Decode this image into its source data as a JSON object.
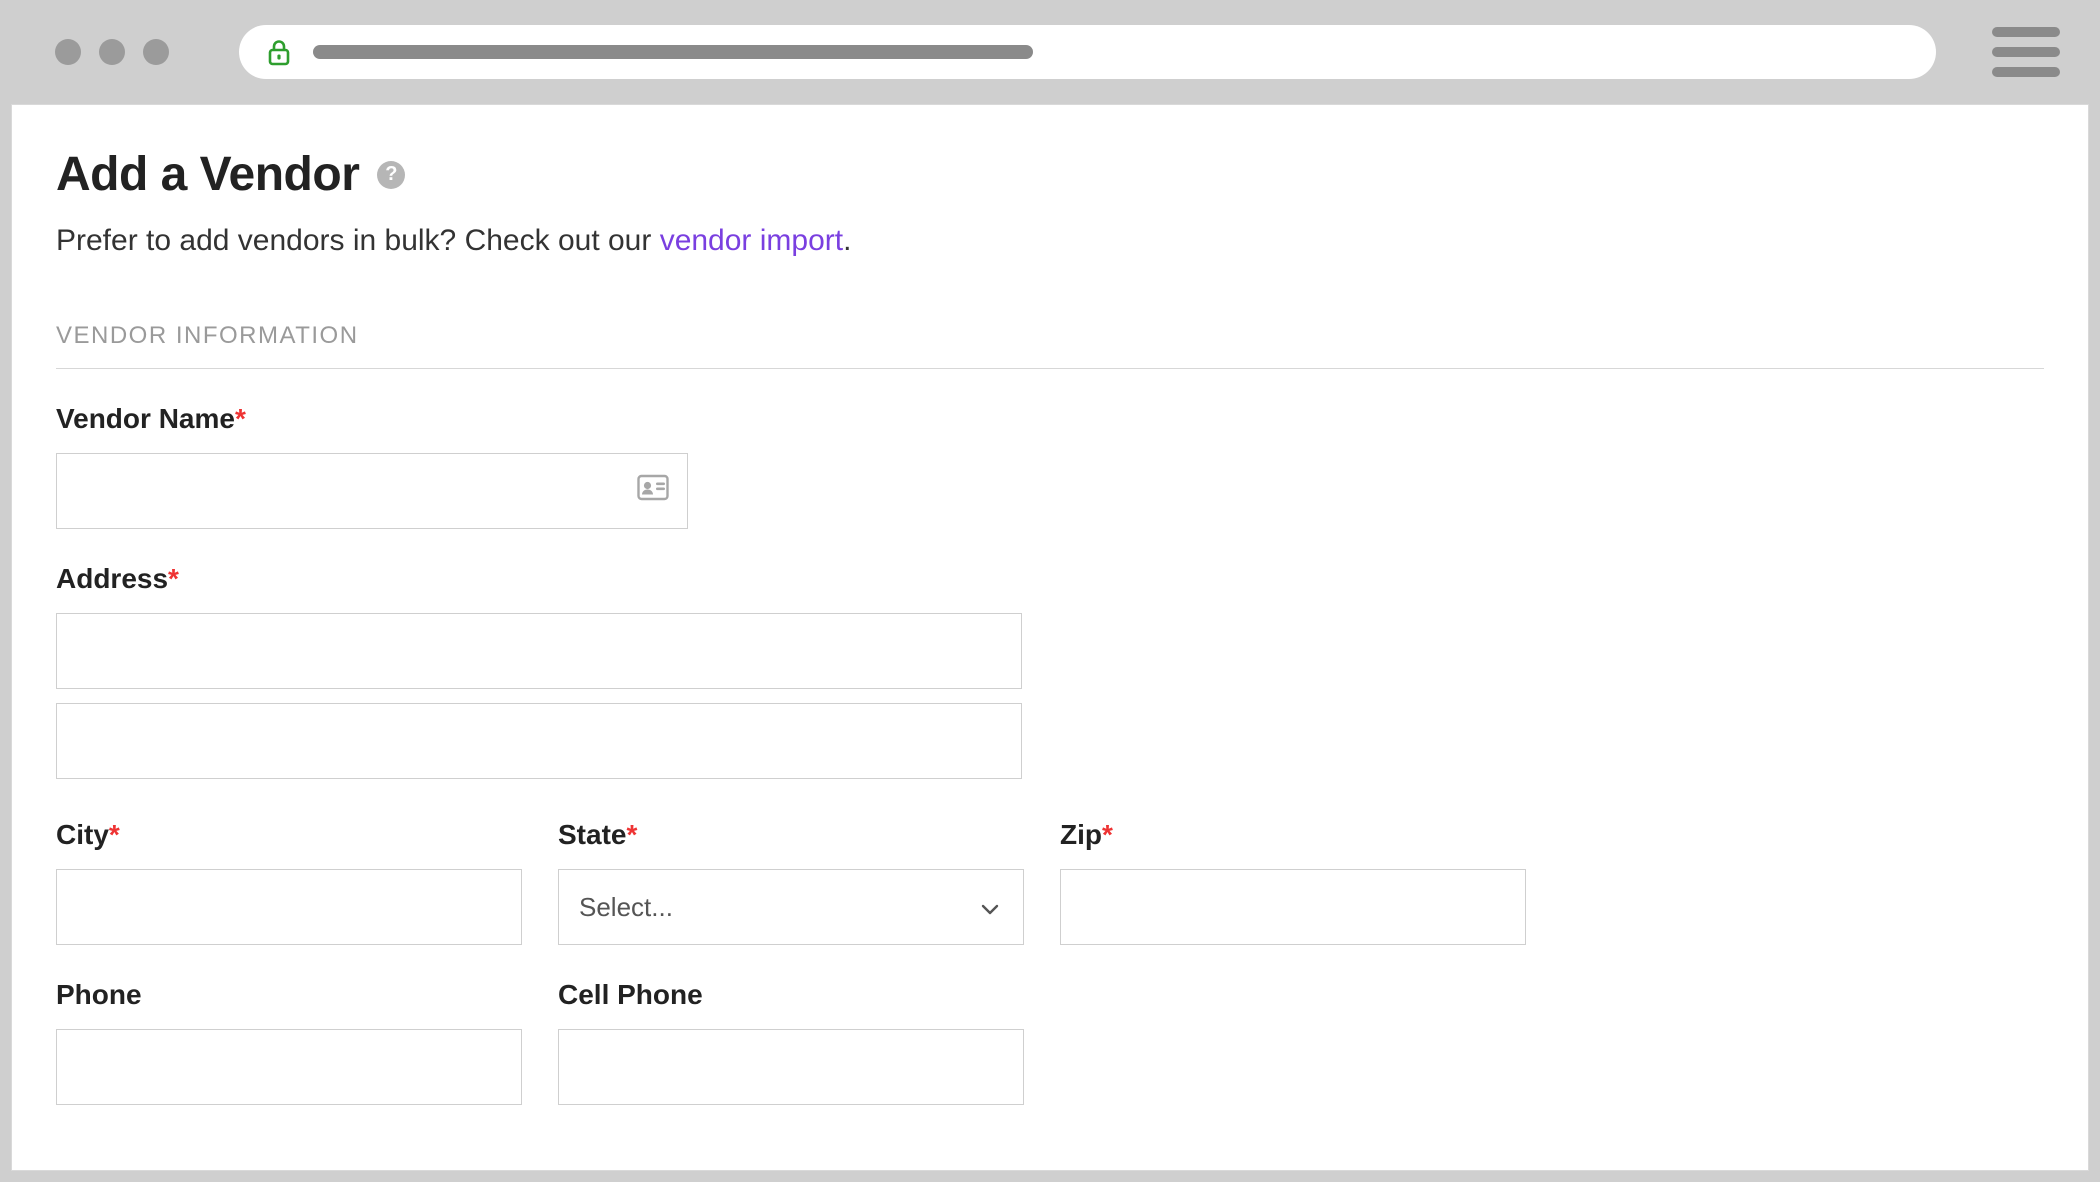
{
  "chrome": {
    "lock_color": "#2e9e2e",
    "menu_label": "menu"
  },
  "page": {
    "title": "Add a Vendor",
    "help_glyph": "?",
    "subtitle_prefix": "Prefer to add vendors in bulk? Check out our ",
    "subtitle_link": "vendor import",
    "subtitle_suffix": "."
  },
  "section": {
    "label": "VENDOR INFORMATION"
  },
  "fields": {
    "vendor_name": {
      "label": "Vendor Name",
      "required": true,
      "value": ""
    },
    "address": {
      "label": "Address",
      "required": true,
      "line1": "",
      "line2": ""
    },
    "city": {
      "label": "City",
      "required": true,
      "value": ""
    },
    "state": {
      "label": "State",
      "required": true,
      "selected": "Select..."
    },
    "zip": {
      "label": "Zip",
      "required": true,
      "value": ""
    },
    "phone": {
      "label": "Phone",
      "required": false,
      "value": ""
    },
    "cell": {
      "label": "Cell Phone",
      "required": false,
      "value": ""
    }
  },
  "required_marker": "*"
}
